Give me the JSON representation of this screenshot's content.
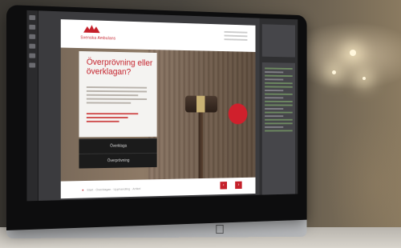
{
  "site": {
    "brand": "Svenska Ambulans",
    "headline": "Överprövning eller överklagan?",
    "badge_text": "",
    "buttons": [
      {
        "label": "Överklaga"
      },
      {
        "label": "Överprövning"
      }
    ],
    "breadcrumb": "Start · Överklagan · Upphandling · Artikel",
    "footer_buttons": [
      {
        "label": "‹"
      },
      {
        "label": "›"
      }
    ]
  },
  "colors": {
    "brand_red": "#c4202a",
    "dark_button": "#1b1b1b"
  },
  "icons": [
    "apple-logo-icon",
    "logo-icon",
    "prev-icon",
    "next-icon"
  ]
}
